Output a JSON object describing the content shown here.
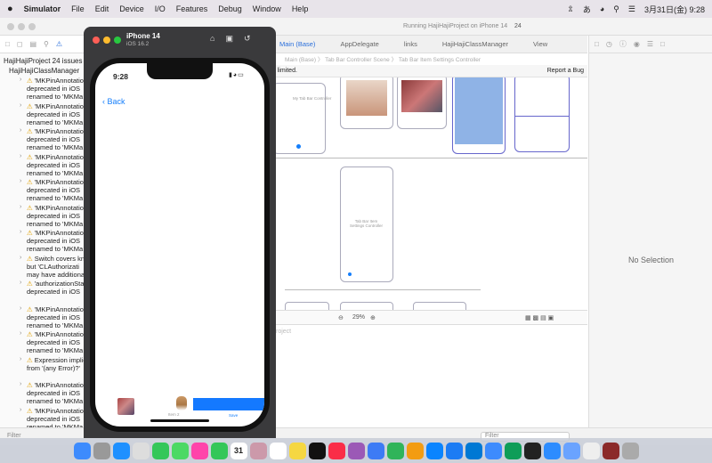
{
  "menubar": {
    "apple": "",
    "app": "Simulator",
    "menus": [
      "File",
      "Edit",
      "Device",
      "I/O",
      "Features",
      "Debug",
      "Window",
      "Help"
    ],
    "datetime": "3月31日(金) 9:28"
  },
  "xcode": {
    "run_status": "Running HajiHajiProject on iPhone 14",
    "issue_count": "24",
    "tabs": [
      "Main (Base)",
      "AppDelegate",
      "links",
      "HajiHajiClassManager",
      "View"
    ],
    "active_tab": "Main (Base)",
    "breadcrumbs": "Main (Base) 〉 Tab Bar Controller Scene 〉 Tab Bar Item Settings Controller",
    "notice": "be limited.",
    "report_bug": "Report a Bug",
    "zoom": "29%",
    "lower_label": "roject",
    "no_selection": "No Selection",
    "filter_left": "Filter",
    "filter_right": "Filter"
  },
  "canvas": {
    "tab_bar_controller_label": "My Tab Bar Controller",
    "settings_controller_label": "Tab Bar Item\nSettings Controller"
  },
  "issues": {
    "project": "HajiHajiProject 24 issues",
    "group": "HajiHajiClassManager",
    "items": [
      {
        "line1": "'MKPinAnnotationV",
        "line2": "deprecated in iOS",
        "line3": "renamed to 'MKMa"
      },
      {
        "line1": "'MKPinAnnotationV",
        "line2": "deprecated in iOS",
        "line3": "renamed to 'MKMa"
      },
      {
        "line1": "'MKPinAnnotationV",
        "line2": "deprecated in iOS",
        "line3": "renamed to 'MKMa"
      },
      {
        "line1": "'MKPinAnnotationV",
        "line2": "deprecated in iOS",
        "line3": "renamed to 'MKMa"
      },
      {
        "line1": "'MKPinAnnotation",
        "line2": "deprecated in iOS",
        "line3": "renamed to 'MKMa"
      },
      {
        "line1": "'MKPinAnnotation",
        "line2": "deprecated in iOS",
        "line3": "renamed to 'MKMa"
      },
      {
        "line1": "'MKPinAnnotationV",
        "line2": "deprecated in iOS",
        "line3": "renamed to 'MKMa"
      },
      {
        "line1": "Switch covers knov",
        "line2": "but 'CLAuthorizati",
        "line3": "may have additiona"
      },
      {
        "line1": "'authorizationStatu",
        "line2": "deprecated in iOS",
        "line3": ""
      },
      {
        "line1": "'MKPinAnnotationV",
        "line2": "deprecated in iOS",
        "line3": "renamed to 'MKMa"
      },
      {
        "line1": "'MKPinAnnotationV",
        "line2": "deprecated in iOS",
        "line3": "renamed to 'MKMa"
      },
      {
        "line1": "Expression implicit",
        "line2": "from '(any Error)?'",
        "line3": ""
      },
      {
        "line1": "'MKPinAnnotationV",
        "line2": "deprecated in iOS",
        "line3": "renamed to 'MKMa"
      },
      {
        "line1": "'MKPinAnnotationV",
        "line2": "deprecated in iOS",
        "line3": "renamed to 'MKMa"
      }
    ]
  },
  "simulator": {
    "device": "iPhone 14",
    "os": "iOS 16.2",
    "time": "9:28",
    "back": "Back",
    "item2_label": "Item 2",
    "save_label": "Save"
  },
  "dock": {
    "icons": [
      "finder",
      "launchpad",
      "safari-compass",
      "chrome",
      "messages",
      "maps",
      "photos",
      "facetime",
      "calendar",
      "contacts",
      "reminders",
      "notes",
      "apple-tv",
      "music",
      "podcasts",
      "keynote",
      "numbers",
      "pages",
      "app-store",
      "xcode",
      "vscode",
      "simulator",
      "sheets",
      "terminal",
      "zoom",
      "preview",
      "textedit",
      "japanese-app",
      "trash"
    ],
    "calendar_day": "31"
  }
}
